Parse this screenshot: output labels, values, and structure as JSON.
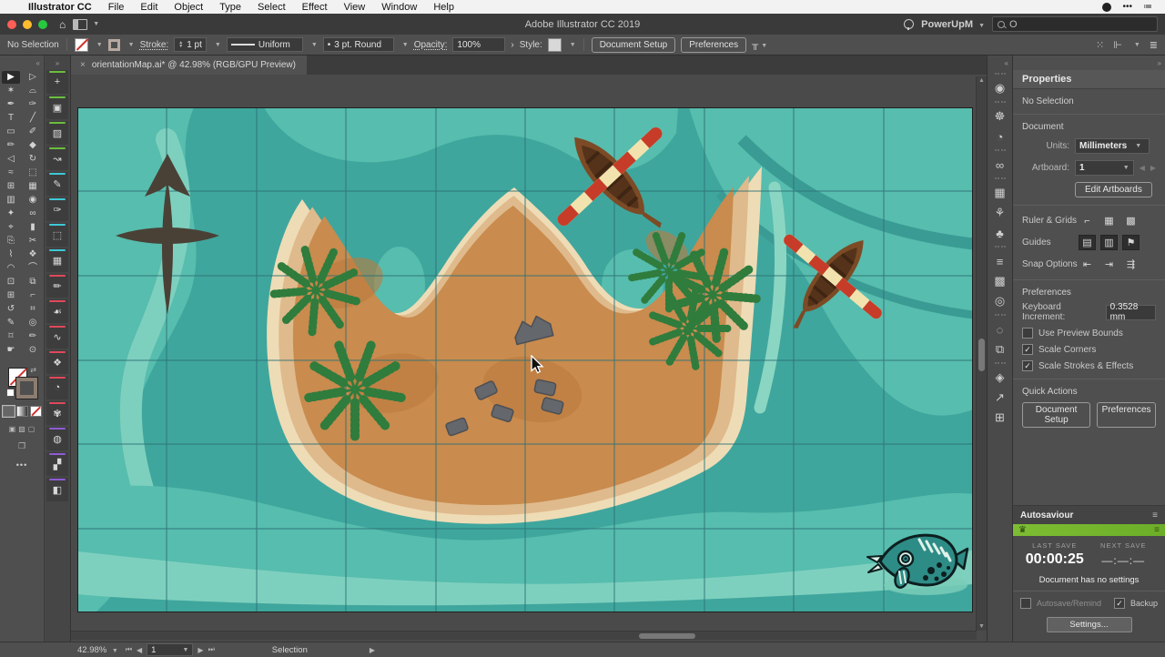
{
  "menubar": {
    "apple": "",
    "items": [
      "Illustrator CC",
      "File",
      "Edit",
      "Object",
      "Type",
      "Select",
      "Effect",
      "View",
      "Window",
      "Help"
    ]
  },
  "titlebar": {
    "title": "Adobe Illustrator CC 2019",
    "workspace": "PowerUpM",
    "search_text": "O"
  },
  "controlbar": {
    "no_selection": "No Selection",
    "stroke_label": "Stroke:",
    "stroke_value": "1 pt",
    "brush_value": "Uniform",
    "corner_bullet": "•",
    "corner_value": "3 pt. Round",
    "opacity_label": "Opacity:",
    "opacity_value": "100%",
    "opacity_more": "›",
    "style_label": "Style:",
    "doc_setup": "Document Setup",
    "preferences": "Preferences",
    "profile_glyph": "╥"
  },
  "tab": {
    "close": "×",
    "title": "orientationMap.ai* @ 42.98% (RGB/GPU Preview)"
  },
  "toolbar": {
    "collapse_glyph": "«",
    "rows": [
      [
        "▶",
        "▷"
      ],
      [
        "✶",
        "⌓"
      ],
      [
        "✒",
        "✑"
      ],
      [
        "T",
        "╱"
      ],
      [
        "▭",
        "✐"
      ],
      [
        "✏",
        "◆"
      ],
      [
        "◁",
        "↻"
      ],
      [
        "≈",
        "⬚"
      ],
      [
        "⊞",
        "▦"
      ],
      [
        "▥",
        "◉"
      ],
      [
        "✦",
        "∞"
      ],
      [
        "⌖",
        "▮"
      ],
      [
        "⎘",
        "✂"
      ],
      [
        "⌇",
        "❖"
      ],
      [
        "◠",
        "⌒"
      ],
      [
        "⊡",
        "⧉"
      ],
      [
        "⊞",
        "⌐"
      ],
      [
        "↺",
        "⌗"
      ],
      [
        "✎",
        "◎"
      ],
      [
        "⌑",
        "✏"
      ],
      [
        "☛",
        "⊙"
      ]
    ],
    "edit_dots": "•••"
  },
  "strip": {
    "expand_glyph": "»",
    "items": [
      {
        "glyph": "+",
        "color": "#6abf3e"
      },
      {
        "glyph": "▣",
        "color": "#6abf3e"
      },
      {
        "glyph": "▨",
        "color": "#6abf3e"
      },
      {
        "glyph": "↝",
        "color": "#6abf3e"
      },
      {
        "glyph": "✎",
        "color": "#3ec8d6"
      },
      {
        "glyph": "✑",
        "color": "#3ec8d6"
      },
      {
        "glyph": "⬚",
        "color": "#3ec8d6"
      },
      {
        "glyph": "▦",
        "color": "#3ec8d6"
      },
      {
        "glyph": "✏",
        "color": "#e0485a"
      },
      {
        "glyph": "☙",
        "color": "#e0485a"
      },
      {
        "glyph": "∿",
        "color": "#e0485a"
      },
      {
        "glyph": "❖",
        "color": "#e0485a"
      },
      {
        "glyph": "◔",
        "color": "#e0485a"
      },
      {
        "glyph": "✾",
        "color": "#e0485a"
      },
      {
        "glyph": "◍",
        "color": "#8e5bd6"
      },
      {
        "glyph": "▞",
        "color": "#8e5bd6"
      },
      {
        "glyph": "◧",
        "color": "#8e5bd6"
      }
    ]
  },
  "dock": {
    "collapse_glyph": "«",
    "icons": [
      {
        "name": "creative-cloud-icon",
        "glyph": "◉"
      },
      {
        "name": "color-icon",
        "glyph": "☸"
      },
      {
        "name": "color-guide-icon",
        "glyph": "◔"
      },
      {
        "name": "links-icon",
        "glyph": "∞"
      },
      {
        "name": "swatches-icon",
        "glyph": "▦"
      },
      {
        "name": "brushes-icon",
        "glyph": "⚘"
      },
      {
        "name": "symbols-icon",
        "glyph": "♣"
      },
      {
        "name": "stroke-icon",
        "glyph": "≡"
      },
      {
        "name": "gradient-icon",
        "glyph": "▩"
      },
      {
        "name": "transparency-icon",
        "glyph": "◎"
      },
      {
        "name": "appearance-icon",
        "glyph": "◌"
      },
      {
        "name": "artboards-icon",
        "glyph": "⧉"
      },
      {
        "name": "layers-icon",
        "glyph": "◈"
      },
      {
        "name": "export-icon",
        "glyph": "↗"
      },
      {
        "name": "arrange-icon",
        "glyph": "⊞"
      }
    ]
  },
  "properties": {
    "expand_glyph": "»",
    "tab": "Properties",
    "no_selection": "No Selection",
    "document": "Document",
    "units_label": "Units:",
    "units_value": "Millimeters",
    "artboard_label": "Artboard:",
    "artboard_value": "1",
    "edit_artboards": "Edit Artboards",
    "ruler_grids": "Ruler & Grids",
    "guides": "Guides",
    "snap_options": "Snap Options",
    "prefs_header": "Preferences",
    "kbd_label": "Keyboard Increment:",
    "kbd_value": "0.3528 mm",
    "checkboxes": [
      {
        "label": "Use Preview Bounds",
        "checked": false
      },
      {
        "label": "Scale Corners",
        "checked": true
      },
      {
        "label": "Scale Strokes & Effects",
        "checked": true
      }
    ],
    "quick_actions": "Quick Actions",
    "qa_doc_setup": "Document Setup",
    "qa_preferences": "Preferences",
    "ruler_icons": [
      "⌐",
      "▦",
      "▩"
    ],
    "guide_icons": [
      "▤",
      "▥",
      "⚑"
    ],
    "snap_icons": [
      "⇤",
      "⇥",
      "⇶"
    ]
  },
  "autosaviour": {
    "title": "Autosaviour",
    "crown": "♛",
    "menu_glyph": "≡",
    "last_save_label": "LAST SAVE",
    "next_save_label": "NEXT SAVE",
    "last_save_value": "00:00:25",
    "next_save_value": "—:—:—",
    "message": "Document has no settings",
    "autosave_label": "Autosave/Remind",
    "autosave_checked": false,
    "backup_label": "Backup",
    "backup_checked": true,
    "settings_button": "Settings..."
  },
  "statusbar": {
    "zoom": "42.98%",
    "nav_first": "⏮",
    "nav_prev": "◀",
    "artboard": "1",
    "nav_next": "▶",
    "nav_last": "⏭",
    "tool": "Selection",
    "more": "▶"
  },
  "canvas": {
    "document_name": "orientationMap.ai",
    "objects": [
      "island",
      "beach-rings",
      "palm-trees",
      "canoe-with-oar-top",
      "canoe-with-oar-right",
      "compass-rose",
      "gray-rocks",
      "tribal-fish",
      "water-contours",
      "grid-lines"
    ]
  },
  "colors": {
    "water-base": "#3fa69d",
    "water-band": "#57bdae",
    "water-band2": "#7ed0be",
    "water-bright": "#8ad6c3",
    "water-dark": "#3a9b94",
    "grid": "#2c7176",
    "sand-outer": "#eedcb6",
    "sand-mid": "#dfba8c",
    "sand-core": "#c98b4e",
    "sand-dark": "#bd7c3e",
    "palm": "#2f7c3d",
    "compass": "#4a4136",
    "boat-rim": "#7c4b26",
    "boat-inner": "#55331b",
    "boat-plank": "#3f2512",
    "oar-red": "#c63c28",
    "oar-cream": "#f2e2ae",
    "rock": "#64676c",
    "rock-edge": "#4c4f54",
    "fish-body": "#2e8c86",
    "fish-dark": "#0d1f20",
    "fish-light": "#dff2e9",
    "fish-shadow": "#79cdb9",
    "accent-green": "#74b82b",
    "traffic-red": "#ff5f57",
    "traffic-yellow": "#febc2e",
    "traffic-green": "#28c840"
  }
}
